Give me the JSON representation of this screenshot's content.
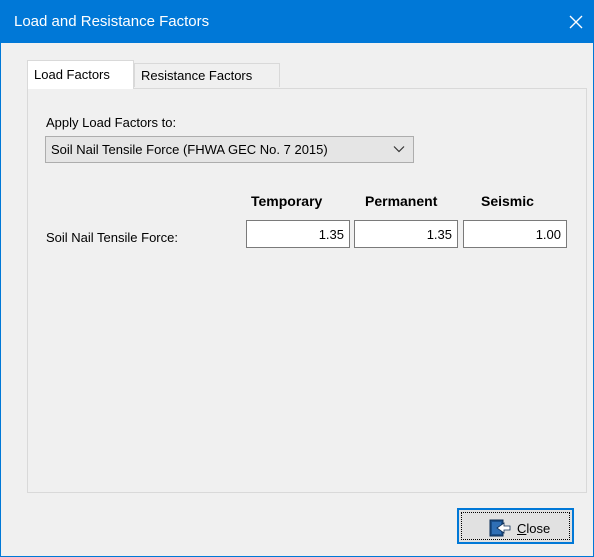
{
  "window": {
    "title": "Load and Resistance Factors"
  },
  "tabs": [
    {
      "label": "Load Factors",
      "active": true
    },
    {
      "label": "Resistance Factors",
      "active": false
    }
  ],
  "load_factors": {
    "apply_label": "Apply Load Factors to:",
    "apply_selected": "Soil Nail Tensile Force (FHWA GEC No. 7 2015)",
    "columns": [
      "Temporary",
      "Permanent",
      "Seismic"
    ],
    "rows": [
      {
        "label": "Soil Nail Tensile Force:",
        "values": [
          "1.35",
          "1.35",
          "1.00"
        ]
      }
    ]
  },
  "buttons": {
    "close_label_first": "C",
    "close_label_rest": "lose"
  },
  "icons": {
    "window_close": "close-icon",
    "dropdown": "chevron-down-icon",
    "close_button": "exit-door-icon"
  },
  "colors": {
    "accent": "#0078d7",
    "window_bg": "#f0f0f0"
  }
}
